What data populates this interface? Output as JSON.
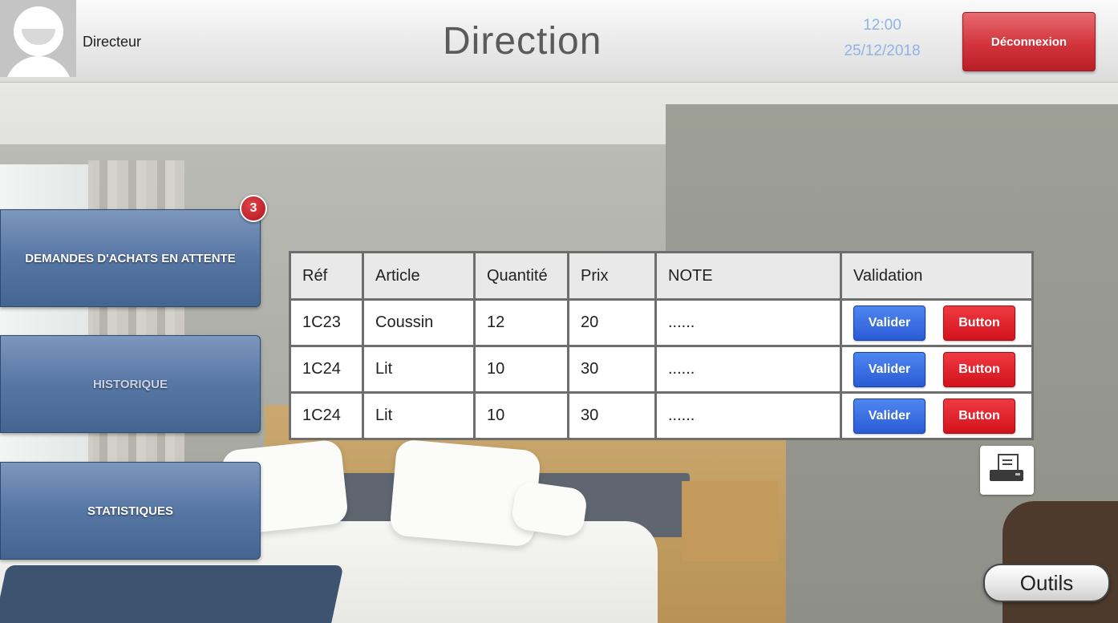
{
  "header": {
    "username": "Directeur",
    "title": "Direction",
    "time": "12:00",
    "date": "25/12/2018",
    "logout_label": "Déconnexion"
  },
  "sidebar": {
    "items": [
      {
        "label": "DEMANDES D'ACHATS EN ATTENTE",
        "badge": "3"
      },
      {
        "label": "HISTORIQUE"
      },
      {
        "label": "STATISTIQUES"
      }
    ]
  },
  "table": {
    "headers": [
      "Réf",
      "Article",
      "Quantité",
      "Prix",
      "NOTE",
      "Validation"
    ],
    "rows": [
      {
        "ref": "1C23",
        "article": "Coussin",
        "quantite": "12",
        "prix": "20",
        "note": "......",
        "validate_label": "Valider",
        "other_label": "Button"
      },
      {
        "ref": "1C24",
        "article": "Lit",
        "quantite": "10",
        "prix": "30",
        "note": "......",
        "validate_label": "Valider",
        "other_label": "Button"
      },
      {
        "ref": "1C24",
        "article": "Lit",
        "quantite": "10",
        "prix": "30",
        "note": "......",
        "validate_label": "Valider",
        "other_label": "Button"
      }
    ]
  },
  "tools": {
    "print_icon": "printer-icon",
    "tools_label": "Outils"
  },
  "colors": {
    "accent_blue": "#2a5bd6",
    "danger_red": "#d3121c",
    "sidebar_blue": "#5676a4",
    "clock_blue": "#8fb3e6"
  }
}
